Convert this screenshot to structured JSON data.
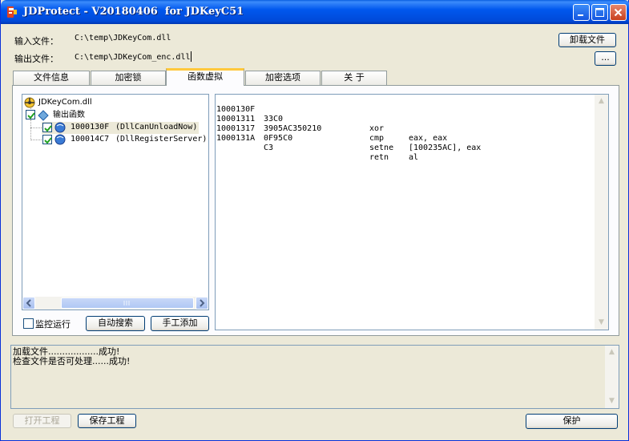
{
  "window": {
    "title": "JDProtect - V20180406  for JDKeyC51"
  },
  "files": {
    "input_label": "输入文件：",
    "input_path": "C:\\temp\\JDKeyCom.dll",
    "output_label": "输出文件：",
    "output_path": "C:\\temp\\JDKeyCom_enc.dll",
    "unload_button": "卸载文件",
    "browse_button": "..."
  },
  "tabs": [
    {
      "label": "文件信息",
      "active": false
    },
    {
      "label": "加密锁",
      "active": false
    },
    {
      "label": "函数虚拟",
      "active": true
    },
    {
      "label": "加密选项",
      "active": false
    },
    {
      "label": "关  于",
      "active": false
    }
  ],
  "tree": {
    "root": "JDKeyCom.dll",
    "group": "输出函数",
    "functions": [
      {
        "address": "1000130F",
        "name": "(DllCanUnloadNow)",
        "checked": true,
        "selected": true
      },
      {
        "address": "100014C7",
        "name": "(DllRegisterServer)",
        "checked": true,
        "selected": false
      }
    ]
  },
  "controls": {
    "monitor_label": "监控运行",
    "monitor_checked": false,
    "auto_search_button": "自动搜索",
    "manual_add_button": "手工添加"
  },
  "disassembly": [
    {
      "addr": "1000130F",
      "bytes": "33C0",
      "mnemonic": "xor",
      "operands": "eax, eax"
    },
    {
      "addr": "10001311",
      "bytes": "3905AC350210",
      "mnemonic": "cmp",
      "operands": "[100235AC], eax"
    },
    {
      "addr": "10001317",
      "bytes": "0F95C0",
      "mnemonic": "setne",
      "operands": "al"
    },
    {
      "addr": "1000131A",
      "bytes": "C3",
      "mnemonic": "retn",
      "operands": ""
    }
  ],
  "log": [
    "加载文件..................成功!",
    "检查文件是否可处理......成功!"
  ],
  "footer": {
    "open_project_button": "打开工程",
    "save_project_button": "保存工程",
    "protect_button": "保护"
  },
  "colors": {
    "titlebar": "#0058EE",
    "window_bg": "#ECE9D8",
    "active_tab_accent": "#FFC83C",
    "selection": "#ECE9D8"
  }
}
